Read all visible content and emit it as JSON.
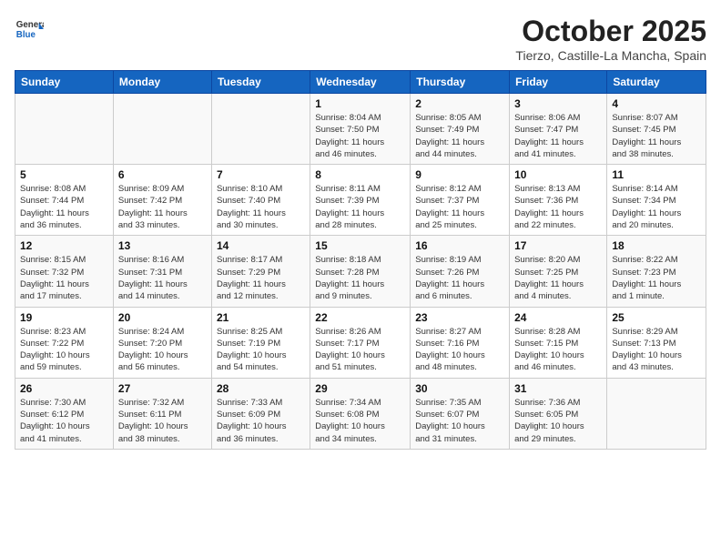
{
  "header": {
    "logo_line1": "General",
    "logo_line2": "Blue",
    "title": "October 2025",
    "subtitle": "Tierzo, Castille-La Mancha, Spain"
  },
  "weekdays": [
    "Sunday",
    "Monday",
    "Tuesday",
    "Wednesday",
    "Thursday",
    "Friday",
    "Saturday"
  ],
  "weeks": [
    [
      {
        "day": "",
        "info": ""
      },
      {
        "day": "",
        "info": ""
      },
      {
        "day": "",
        "info": ""
      },
      {
        "day": "1",
        "info": "Sunrise: 8:04 AM\nSunset: 7:50 PM\nDaylight: 11 hours\nand 46 minutes."
      },
      {
        "day": "2",
        "info": "Sunrise: 8:05 AM\nSunset: 7:49 PM\nDaylight: 11 hours\nand 44 minutes."
      },
      {
        "day": "3",
        "info": "Sunrise: 8:06 AM\nSunset: 7:47 PM\nDaylight: 11 hours\nand 41 minutes."
      },
      {
        "day": "4",
        "info": "Sunrise: 8:07 AM\nSunset: 7:45 PM\nDaylight: 11 hours\nand 38 minutes."
      }
    ],
    [
      {
        "day": "5",
        "info": "Sunrise: 8:08 AM\nSunset: 7:44 PM\nDaylight: 11 hours\nand 36 minutes."
      },
      {
        "day": "6",
        "info": "Sunrise: 8:09 AM\nSunset: 7:42 PM\nDaylight: 11 hours\nand 33 minutes."
      },
      {
        "day": "7",
        "info": "Sunrise: 8:10 AM\nSunset: 7:40 PM\nDaylight: 11 hours\nand 30 minutes."
      },
      {
        "day": "8",
        "info": "Sunrise: 8:11 AM\nSunset: 7:39 PM\nDaylight: 11 hours\nand 28 minutes."
      },
      {
        "day": "9",
        "info": "Sunrise: 8:12 AM\nSunset: 7:37 PM\nDaylight: 11 hours\nand 25 minutes."
      },
      {
        "day": "10",
        "info": "Sunrise: 8:13 AM\nSunset: 7:36 PM\nDaylight: 11 hours\nand 22 minutes."
      },
      {
        "day": "11",
        "info": "Sunrise: 8:14 AM\nSunset: 7:34 PM\nDaylight: 11 hours\nand 20 minutes."
      }
    ],
    [
      {
        "day": "12",
        "info": "Sunrise: 8:15 AM\nSunset: 7:32 PM\nDaylight: 11 hours\nand 17 minutes."
      },
      {
        "day": "13",
        "info": "Sunrise: 8:16 AM\nSunset: 7:31 PM\nDaylight: 11 hours\nand 14 minutes."
      },
      {
        "day": "14",
        "info": "Sunrise: 8:17 AM\nSunset: 7:29 PM\nDaylight: 11 hours\nand 12 minutes."
      },
      {
        "day": "15",
        "info": "Sunrise: 8:18 AM\nSunset: 7:28 PM\nDaylight: 11 hours\nand 9 minutes."
      },
      {
        "day": "16",
        "info": "Sunrise: 8:19 AM\nSunset: 7:26 PM\nDaylight: 11 hours\nand 6 minutes."
      },
      {
        "day": "17",
        "info": "Sunrise: 8:20 AM\nSunset: 7:25 PM\nDaylight: 11 hours\nand 4 minutes."
      },
      {
        "day": "18",
        "info": "Sunrise: 8:22 AM\nSunset: 7:23 PM\nDaylight: 11 hours\nand 1 minute."
      }
    ],
    [
      {
        "day": "19",
        "info": "Sunrise: 8:23 AM\nSunset: 7:22 PM\nDaylight: 10 hours\nand 59 minutes."
      },
      {
        "day": "20",
        "info": "Sunrise: 8:24 AM\nSunset: 7:20 PM\nDaylight: 10 hours\nand 56 minutes."
      },
      {
        "day": "21",
        "info": "Sunrise: 8:25 AM\nSunset: 7:19 PM\nDaylight: 10 hours\nand 54 minutes."
      },
      {
        "day": "22",
        "info": "Sunrise: 8:26 AM\nSunset: 7:17 PM\nDaylight: 10 hours\nand 51 minutes."
      },
      {
        "day": "23",
        "info": "Sunrise: 8:27 AM\nSunset: 7:16 PM\nDaylight: 10 hours\nand 48 minutes."
      },
      {
        "day": "24",
        "info": "Sunrise: 8:28 AM\nSunset: 7:15 PM\nDaylight: 10 hours\nand 46 minutes."
      },
      {
        "day": "25",
        "info": "Sunrise: 8:29 AM\nSunset: 7:13 PM\nDaylight: 10 hours\nand 43 minutes."
      }
    ],
    [
      {
        "day": "26",
        "info": "Sunrise: 7:30 AM\nSunset: 6:12 PM\nDaylight: 10 hours\nand 41 minutes."
      },
      {
        "day": "27",
        "info": "Sunrise: 7:32 AM\nSunset: 6:11 PM\nDaylight: 10 hours\nand 38 minutes."
      },
      {
        "day": "28",
        "info": "Sunrise: 7:33 AM\nSunset: 6:09 PM\nDaylight: 10 hours\nand 36 minutes."
      },
      {
        "day": "29",
        "info": "Sunrise: 7:34 AM\nSunset: 6:08 PM\nDaylight: 10 hours\nand 34 minutes."
      },
      {
        "day": "30",
        "info": "Sunrise: 7:35 AM\nSunset: 6:07 PM\nDaylight: 10 hours\nand 31 minutes."
      },
      {
        "day": "31",
        "info": "Sunrise: 7:36 AM\nSunset: 6:05 PM\nDaylight: 10 hours\nand 29 minutes."
      },
      {
        "day": "",
        "info": ""
      }
    ]
  ]
}
